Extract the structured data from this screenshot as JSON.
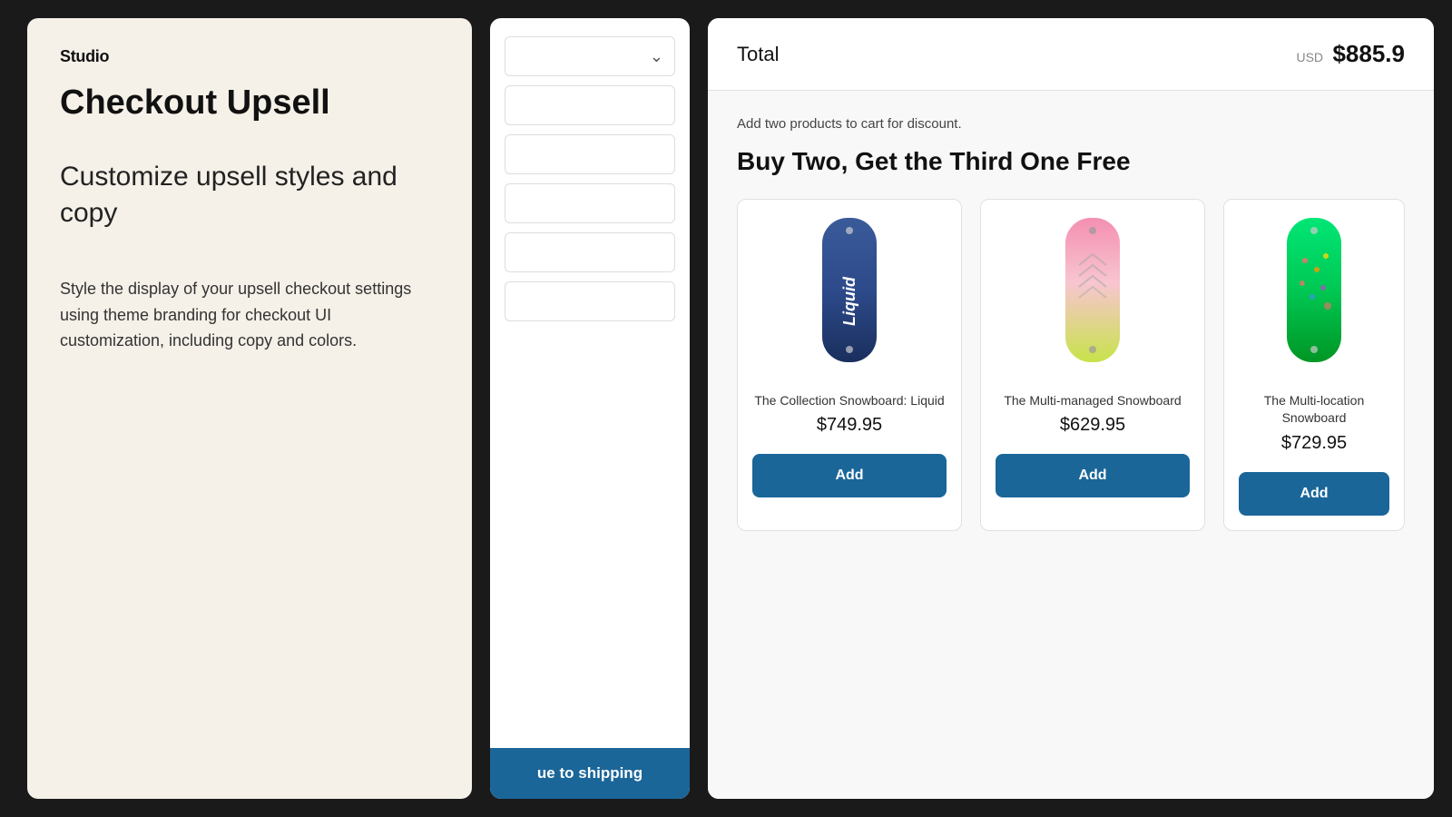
{
  "left_panel": {
    "logo": "Studio",
    "title": "Checkout Upsell",
    "description_main": "Customize upsell styles and copy",
    "description_sub": "Style the display of your upsell checkout settings using theme branding for checkout UI customization, including copy and colors."
  },
  "middle_panel": {
    "fields": [
      {
        "id": "field1",
        "has_chevron": true
      },
      {
        "id": "field2",
        "has_chevron": false
      },
      {
        "id": "field3",
        "has_chevron": false
      },
      {
        "id": "field4",
        "has_chevron": false
      },
      {
        "id": "field5",
        "has_chevron": false
      },
      {
        "id": "field6",
        "has_chevron": false
      }
    ],
    "continue_button_label": "ue to shipping"
  },
  "right_panel": {
    "total_label": "Total",
    "total_currency": "USD",
    "total_amount": "$885.9",
    "discount_note": "Add two products to cart for discount.",
    "upsell_title": "Buy Two, Get the Third One Free",
    "products": [
      {
        "name": "The Collection Snowboard: Liquid",
        "price": "$749.95",
        "add_label": "Add",
        "color_top": "#4a6fa5",
        "color_bottom": "#2c3e6b"
      },
      {
        "name": "The Multi-managed Snowboard",
        "price": "$629.95",
        "add_label": "Add",
        "color_top": "#f48fb1",
        "color_bottom": "#c8e34a"
      },
      {
        "name": "The Multi-location Snowboard",
        "price": "$729.95",
        "add_label": "Add",
        "color_top": "#4cdb8a",
        "color_bottom": "#00c853"
      }
    ]
  }
}
